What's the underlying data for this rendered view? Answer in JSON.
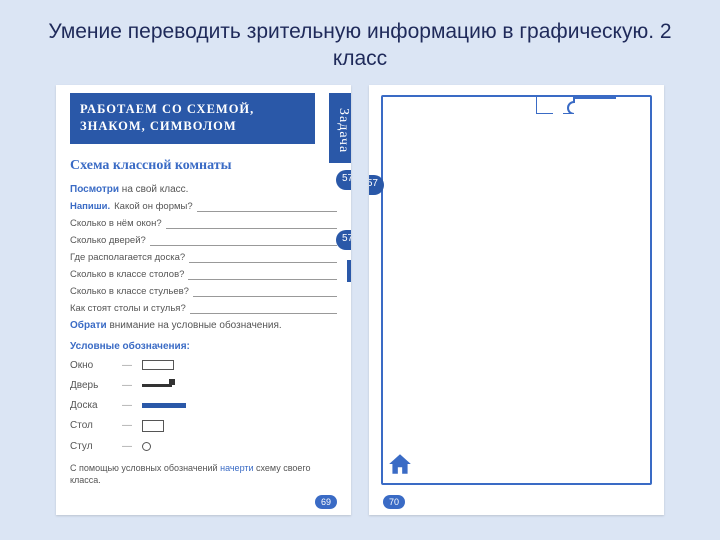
{
  "title": "Умение переводить зрительную информацию в графическую. 2 класс",
  "left": {
    "banner_l1": "РАБОТАЕМ СО СХЕМОЙ,",
    "banner_l2": "ЗНАКОМ, СИМВОЛОМ",
    "vtab": "Задача",
    "subtitle": "Схема классной комнаты",
    "instr1_b": "Посмотри",
    "instr1": " на свой класс.",
    "instr2_b": "Напиши.",
    "q1": "Какой он формы?",
    "q2": "Сколько в нём окон?",
    "q3": "Сколько дверей?",
    "q4": "Где располагается доска?",
    "q5": "Сколько в классе столов?",
    "q6": "Сколько в классе стульев?",
    "q7": "Как стоят столы и стулья?",
    "instr3_b": "Обрати",
    "instr3": " внимание на условные обозначения.",
    "legend_title": "Условные обозначения:",
    "legend": {
      "window": "Окно",
      "door": "Дверь",
      "board": "Доска",
      "table": "Стол",
      "chair": "Стул"
    },
    "foot1": "С помощью условных обозначений ",
    "foot_hl": "начерти",
    "foot2": " схему своего класса.",
    "pin1": "57",
    "pin2": "57",
    "pagenum": "69"
  },
  "right": {
    "pin1": "57",
    "pagenum": "70"
  }
}
